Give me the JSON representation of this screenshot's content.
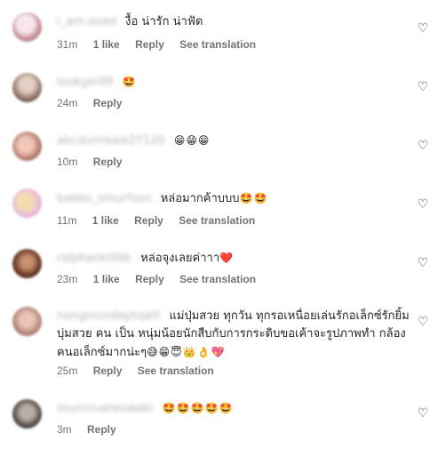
{
  "comments": [
    {
      "username": "i_am.ooad",
      "text": "งื้อ น่ารัก น่าฟัด",
      "emoji": "",
      "time": "31m",
      "likes": "1 like",
      "reply": "Reply",
      "translate": "See translation",
      "avatar_color": "#c9a0a8"
    },
    {
      "username": "lookgei99",
      "text": "",
      "emoji": "🤩",
      "time": "24m",
      "likes": "",
      "reply": "Reply",
      "translate": "",
      "avatar_color": "#8a6e62"
    },
    {
      "username": "abcdunreale2Y120",
      "text": "",
      "emoji": "😁😁😁",
      "time": "10m",
      "likes": "",
      "reply": "Reply",
      "translate": "",
      "avatar_color": "#b98272"
    },
    {
      "username": "babbs_smurfson",
      "text": "หล่อมากค้าบบบ",
      "emoji": "🤩🤩",
      "time": "11m",
      "likes": "1 like",
      "reply": "Reply",
      "translate": "See translation",
      "avatar_color": "#e6b8dc"
    },
    {
      "username": "ralphaski0bb",
      "text": "หล่อจุงเลยค่าาา",
      "emoji": "❤️",
      "time": "23m",
      "likes": "1 like",
      "reply": "Reply",
      "translate": "See translation",
      "avatar_color": "#6a3a26"
    },
    {
      "username": "nongmsndeptqatt",
      "text": "แม่ปุ่มสวย ทุกวัน ทุกรอเหนื่อยเล่นรักอเล็กซ์รักยิ้ม บุ่มสวย คน เป็น หนุ่มน้อยนักสืบกับการกระดิบขอเค้าจะรูปภาพทำ กล้อง คนอเล็กซ์มากน่ะๆ",
      "emoji": "😅😁😇👑👌💖",
      "time": "25m",
      "likes": "",
      "reply": "Reply",
      "translate": "See translation",
      "avatar_color": "#b88a7e"
    },
    {
      "username": "mumnuareowaki",
      "text": "",
      "emoji": "🤩🤩🤩🤩🤩",
      "time": "3m",
      "likes": "",
      "reply": "Reply",
      "translate": "",
      "avatar_color": "#5c524e"
    }
  ],
  "icons": {
    "like": "heart-outline-icon"
  },
  "colors": {
    "text": "#262626",
    "meta": "#737373"
  }
}
